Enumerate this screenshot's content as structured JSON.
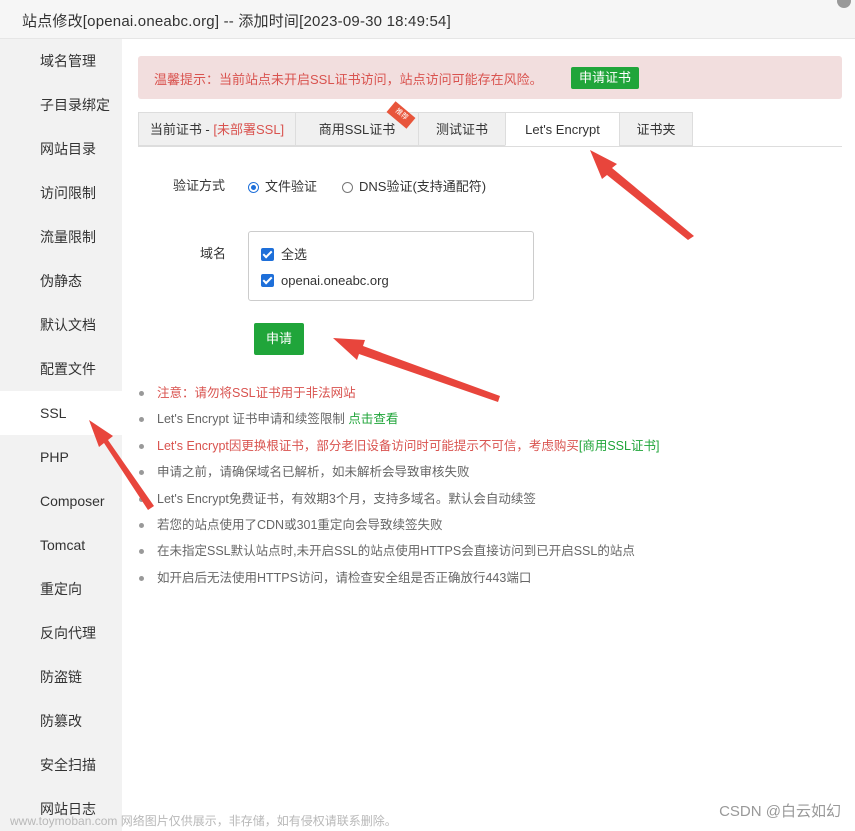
{
  "window": {
    "title": "站点修改[openai.oneabc.org] -- 添加时间[2023-09-30 18:49:54]"
  },
  "sidebar": {
    "items": [
      {
        "label": "域名管理"
      },
      {
        "label": "子目录绑定"
      },
      {
        "label": "网站目录"
      },
      {
        "label": "访问限制"
      },
      {
        "label": "流量限制"
      },
      {
        "label": "伪静态"
      },
      {
        "label": "默认文档"
      },
      {
        "label": "配置文件"
      },
      {
        "label": "SSL"
      },
      {
        "label": "PHP"
      },
      {
        "label": "Composer"
      },
      {
        "label": "Tomcat"
      },
      {
        "label": "重定向"
      },
      {
        "label": "反向代理"
      },
      {
        "label": "防盗链"
      },
      {
        "label": "防篡改"
      },
      {
        "label": "安全扫描"
      },
      {
        "label": "网站日志"
      }
    ],
    "active": "SSL"
  },
  "warning": {
    "text": "温馨提示：当前站点未开启SSL证书访问，站点访问可能存在风险。",
    "button": "申请证书"
  },
  "tabs": {
    "current_prefix": "当前证书 - ",
    "current_status": "[未部署SSL]",
    "commercial": "商用SSL证书",
    "commercial_badge": "推荐",
    "test": "测试证书",
    "letsencrypt": "Let's Encrypt",
    "folder": "证书夹",
    "active": "Let's Encrypt"
  },
  "form": {
    "verify_label": "验证方式",
    "verify_options": [
      "文件验证",
      "DNS验证(支持通配符)"
    ],
    "verify_selected": "文件验证",
    "domain_label": "域名",
    "domains": [
      {
        "label": "全选",
        "checked": true
      },
      {
        "label": "openai.oneabc.org",
        "checked": true
      }
    ],
    "apply_button": "申请"
  },
  "notes": {
    "n1": "注意：请勿将SSL证书用于非法网站",
    "n2_text": "Let's Encrypt 证书申请和续签限制 ",
    "n2_link": "点击查看",
    "n3_text": "Let's Encrypt因更换根证书，部分老旧设备访问时可能提示不可信，考虑购买",
    "n3_link": "[商用SSL证书]",
    "n4": "申请之前，请确保域名已解析，如未解析会导致审核失败",
    "n5": "Let's Encrypt免费证书，有效期3个月，支持多域名。默认会自动续签",
    "n6": "若您的站点使用了CDN或301重定向会导致续签失败",
    "n7": "在未指定SSL默认站点时,未开启SSL的站点使用HTTPS会直接访问到已开启SSL的站点",
    "n8": "如开启后无法使用HTTPS访问，请检查安全组是否正确放行443端口"
  },
  "watermark": {
    "left": "www.toymoban.com 网络图片仅供展示，非存储，如有侵权请联系删除。",
    "right": "CSDN @白云如幻"
  },
  "colors": {
    "accent_green": "#20a53a",
    "danger_red": "#d9534f",
    "arrow_red": "#e8453c"
  }
}
